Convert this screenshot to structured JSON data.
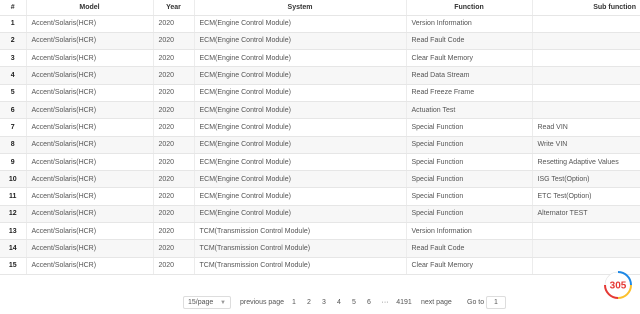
{
  "table": {
    "headers": [
      "#",
      "Model",
      "Year",
      "System",
      "Function",
      "Sub function"
    ],
    "rows": [
      {
        "n": "1",
        "model": "Accent/Solaris(HCR)",
        "year": "2020",
        "system": "ECM(Engine Control Module)",
        "function": "Version Information",
        "sub": ""
      },
      {
        "n": "2",
        "model": "Accent/Solaris(HCR)",
        "year": "2020",
        "system": "ECM(Engine Control Module)",
        "function": "Read Fault Code",
        "sub": ""
      },
      {
        "n": "3",
        "model": "Accent/Solaris(HCR)",
        "year": "2020",
        "system": "ECM(Engine Control Module)",
        "function": "Clear Fault Memory",
        "sub": ""
      },
      {
        "n": "4",
        "model": "Accent/Solaris(HCR)",
        "year": "2020",
        "system": "ECM(Engine Control Module)",
        "function": "Read Data Stream",
        "sub": ""
      },
      {
        "n": "5",
        "model": "Accent/Solaris(HCR)",
        "year": "2020",
        "system": "ECM(Engine Control Module)",
        "function": "Read Freeze Frame",
        "sub": ""
      },
      {
        "n": "6",
        "model": "Accent/Solaris(HCR)",
        "year": "2020",
        "system": "ECM(Engine Control Module)",
        "function": "Actuation Test",
        "sub": ""
      },
      {
        "n": "7",
        "model": "Accent/Solaris(HCR)",
        "year": "2020",
        "system": "ECM(Engine Control Module)",
        "function": "Special Function",
        "sub": "Read VIN"
      },
      {
        "n": "8",
        "model": "Accent/Solaris(HCR)",
        "year": "2020",
        "system": "ECM(Engine Control Module)",
        "function": "Special Function",
        "sub": "Write VIN"
      },
      {
        "n": "9",
        "model": "Accent/Solaris(HCR)",
        "year": "2020",
        "system": "ECM(Engine Control Module)",
        "function": "Special Function",
        "sub": "Resetting Adaptive Values"
      },
      {
        "n": "10",
        "model": "Accent/Solaris(HCR)",
        "year": "2020",
        "system": "ECM(Engine Control Module)",
        "function": "Special Function",
        "sub": "ISG Test(Option)"
      },
      {
        "n": "11",
        "model": "Accent/Solaris(HCR)",
        "year": "2020",
        "system": "ECM(Engine Control Module)",
        "function": "Special Function",
        "sub": "ETC Test(Option)"
      },
      {
        "n": "12",
        "model": "Accent/Solaris(HCR)",
        "year": "2020",
        "system": "ECM(Engine Control Module)",
        "function": "Special Function",
        "sub": "Alternator TEST"
      },
      {
        "n": "13",
        "model": "Accent/Solaris(HCR)",
        "year": "2020",
        "system": "TCM(Transmission Control Module)",
        "function": "Version Information",
        "sub": ""
      },
      {
        "n": "14",
        "model": "Accent/Solaris(HCR)",
        "year": "2020",
        "system": "TCM(Transmission Control Module)",
        "function": "Read Fault Code",
        "sub": ""
      },
      {
        "n": "15",
        "model": "Accent/Solaris(HCR)",
        "year": "2020",
        "system": "TCM(Transmission Control Module)",
        "function": "Clear Fault Memory",
        "sub": ""
      }
    ]
  },
  "pagination": {
    "page_size": "15/page",
    "prev_label": "previous page",
    "pages": [
      "1",
      "2",
      "3",
      "4",
      "5",
      "6",
      "···",
      "4191"
    ],
    "next_label": "next page",
    "goto_label": "Go to",
    "goto_value": "1"
  },
  "logo": {
    "text": "305",
    "brand_colors": [
      "#e53935",
      "#fbc02d",
      "#1e88e5"
    ]
  }
}
